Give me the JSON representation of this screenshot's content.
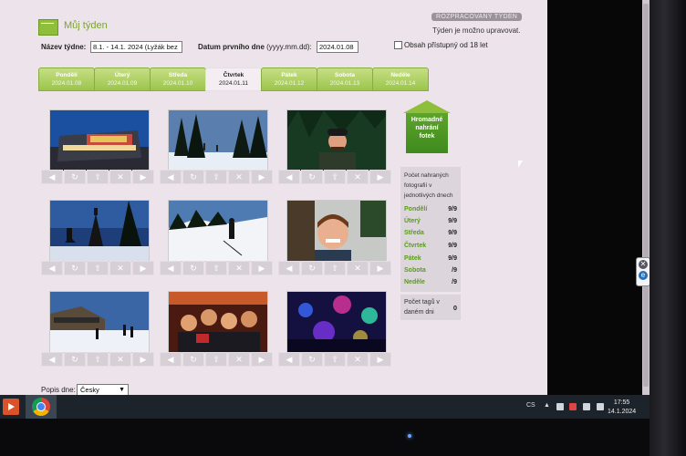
{
  "header": {
    "title": "Můj týden",
    "status_badge": "ROZPRACOVANÝ TÝDEN",
    "editable_note": "Týden je možno upravovat."
  },
  "form": {
    "week_name_label": "Název týdne:",
    "week_name_value": "8.1. - 14.1. 2024 (Lyžák bez",
    "first_day_label": "Datum prvního dne",
    "first_day_format": "(yyyy.mm.dd):",
    "first_day_value": "2024.01.08",
    "adult_label": "Obsah přístupný od 18 let",
    "adult_checked": false
  },
  "tabs": [
    {
      "day": "Pondělí",
      "date": "2024.01.08",
      "active": false
    },
    {
      "day": "Úterý",
      "date": "2024.01.09",
      "active": false
    },
    {
      "day": "Středa",
      "date": "2024.01.10",
      "active": false
    },
    {
      "day": "Čtvrtek",
      "date": "2024.01.11",
      "active": true
    },
    {
      "day": "Pátek",
      "date": "2024.01.12",
      "active": false
    },
    {
      "day": "Sobota",
      "date": "2024.01.13",
      "active": false
    },
    {
      "day": "Neděle",
      "date": "2024.01.14",
      "active": false
    }
  ],
  "upload_button": {
    "line1": "Hromadné",
    "line2": "nahrání",
    "line3": "fotek"
  },
  "photos": [
    {
      "subject": "building-at-night"
    },
    {
      "subject": "snowy-forest-path"
    },
    {
      "subject": "man-in-beanie"
    },
    {
      "subject": "ski-tower-silhouette"
    },
    {
      "subject": "skier-on-slope"
    },
    {
      "subject": "smiling-boy"
    },
    {
      "subject": "skiers-near-cabin"
    },
    {
      "subject": "group-selfie"
    },
    {
      "subject": "disco-lights"
    }
  ],
  "photo_controls": [
    "arrow-left-icon",
    "rotate-icon",
    "upload-icon",
    "delete-icon",
    "arrow-right-icon"
  ],
  "stats": {
    "title": "Počet nahraných fotografií v jednotlivých dnech",
    "rows": [
      {
        "day": "Pondělí",
        "count": "9/9"
      },
      {
        "day": "Úterý",
        "count": "9/9"
      },
      {
        "day": "Středa",
        "count": "9/9"
      },
      {
        "day": "Čtvrtek",
        "count": "9/9"
      },
      {
        "day": "Pátek",
        "count": "9/9"
      },
      {
        "day": "Sobota",
        "count": "/9"
      },
      {
        "day": "Neděle",
        "count": "/9"
      }
    ],
    "tags_label": "Počet tagů v daném dni",
    "tags_value": "0"
  },
  "footer": {
    "description_label": "Popis dne:",
    "language_value": "Česky"
  },
  "taskbar": {
    "lang": "CS",
    "time": "17:55",
    "date": "14.1.2024"
  },
  "colors": {
    "accent_green": "#8fbf3a",
    "day_name_green": "#5a9a1d",
    "page_bg": "#ece4ea"
  }
}
